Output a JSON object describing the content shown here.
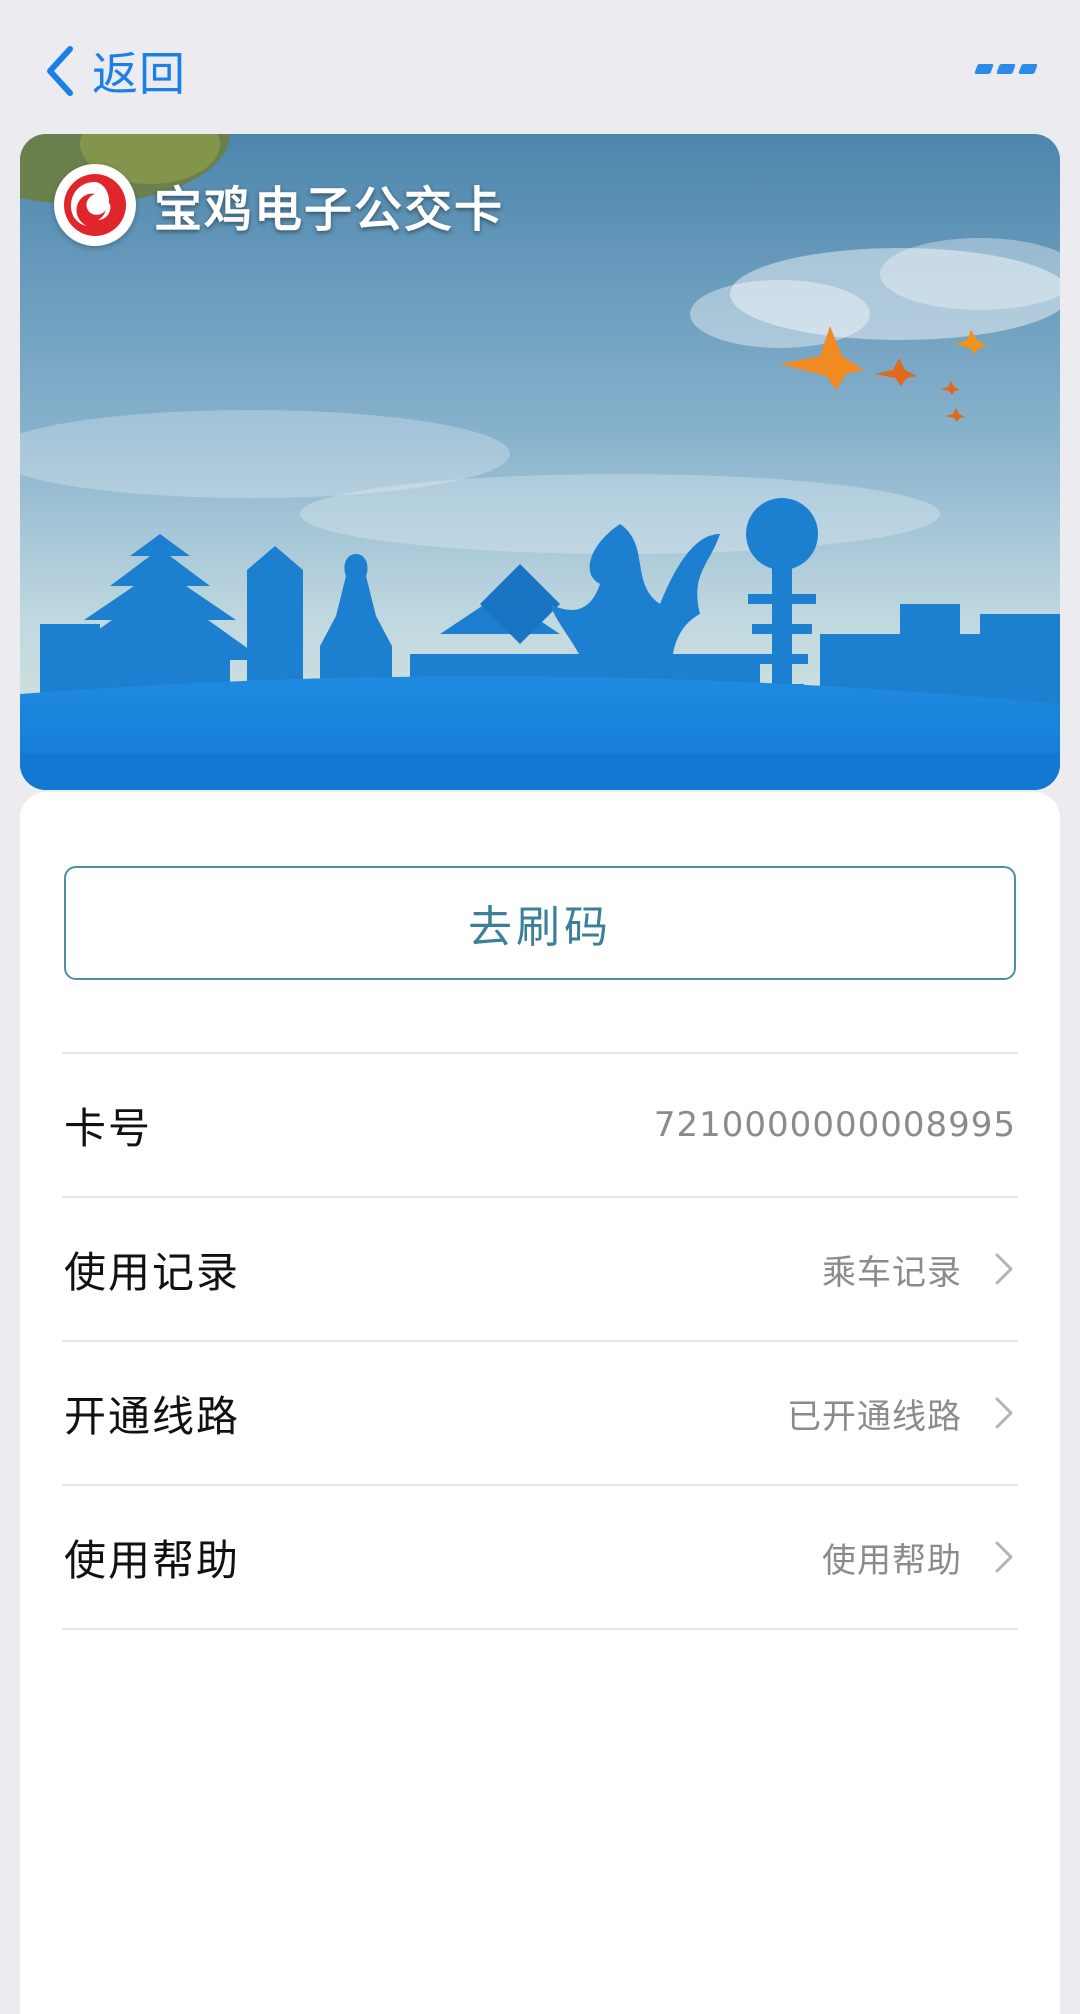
{
  "nav": {
    "back_label": "返回",
    "back_icon": "chevron-left-icon",
    "more_icon": "more-icon"
  },
  "card": {
    "title": "宝鸡电子公交卡",
    "logo": "baoji-logo"
  },
  "actions": {
    "scan_label": "去刷码"
  },
  "rows": [
    {
      "label": "卡号",
      "value": "7210000000008995"
    },
    {
      "label": "使用记录",
      "value": "乘车记录"
    },
    {
      "label": "开通线路",
      "value": "已开通线路"
    },
    {
      "label": "使用帮助",
      "value": "使用帮助"
    }
  ],
  "colors": {
    "accent_blue": "#1b80e5",
    "button_border": "#4f8fa6",
    "button_text": "#3b7f98",
    "logo_red": "#e0262b"
  }
}
